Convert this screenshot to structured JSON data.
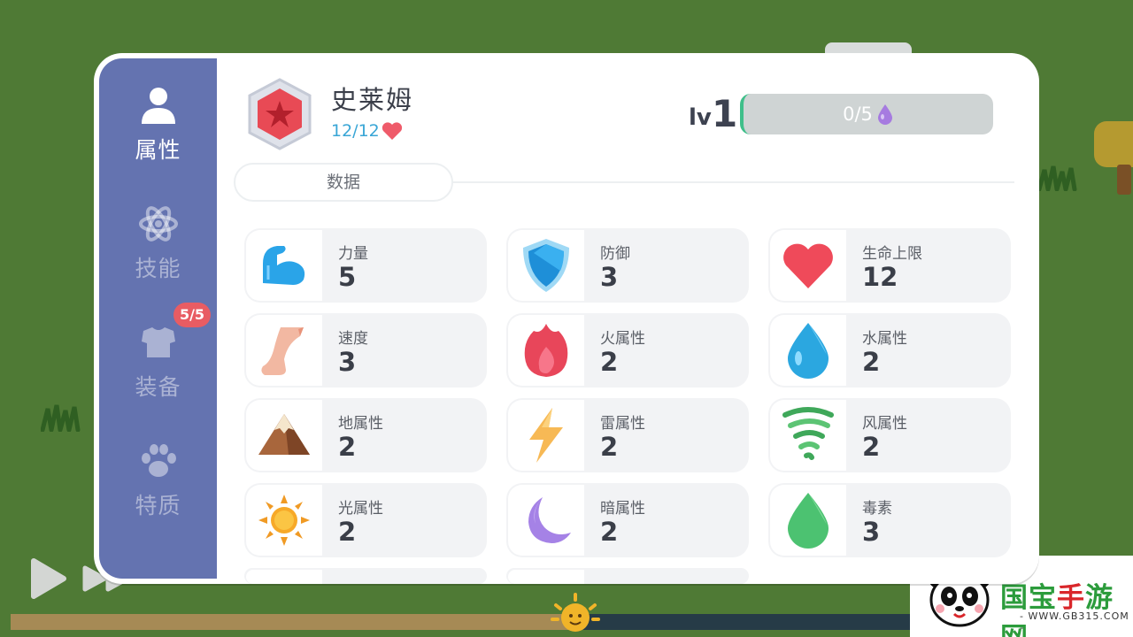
{
  "character": {
    "name": "史莱姆",
    "hp": "12/12",
    "level_prefix": "lv",
    "level": "1",
    "xp": "0/5"
  },
  "sidebar": {
    "items": [
      {
        "label": "属性",
        "icon": "person-icon",
        "active": true
      },
      {
        "label": "技能",
        "icon": "atom-icon",
        "active": false
      },
      {
        "label": "装备",
        "icon": "armor-icon",
        "active": false
      },
      {
        "label": "特质",
        "icon": "paw-icon",
        "active": false
      }
    ],
    "equipment_badge": "5/5"
  },
  "tabs": {
    "data_tab": "数据"
  },
  "stats": [
    {
      "label": "力量",
      "value": "5",
      "icon": "muscle-icon"
    },
    {
      "label": "防御",
      "value": "3",
      "icon": "shield-icon"
    },
    {
      "label": "生命上限",
      "value": "12",
      "icon": "heart-icon"
    },
    {
      "label": "速度",
      "value": "3",
      "icon": "foot-icon"
    },
    {
      "label": "火属性",
      "value": "2",
      "icon": "fire-icon"
    },
    {
      "label": "水属性",
      "value": "2",
      "icon": "water-drop-icon"
    },
    {
      "label": "地属性",
      "value": "2",
      "icon": "mountain-icon"
    },
    {
      "label": "雷属性",
      "value": "2",
      "icon": "lightning-icon"
    },
    {
      "label": "风属性",
      "value": "2",
      "icon": "tornado-icon"
    },
    {
      "label": "光属性",
      "value": "2",
      "icon": "sun-icon"
    },
    {
      "label": "暗属性",
      "value": "2",
      "icon": "moon-icon"
    },
    {
      "label": "毒素",
      "value": "3",
      "icon": "poison-drop-icon"
    }
  ],
  "watermark": {
    "title_green": "国宝",
    "title_red": "手",
    "title_green2": "游网",
    "url": "- WWW.GB315.COM -"
  },
  "colors": {
    "sidebar": "#6473b0",
    "background": "#4f7a35",
    "hp_text": "#39a6d6",
    "badge": "#e85c63"
  }
}
